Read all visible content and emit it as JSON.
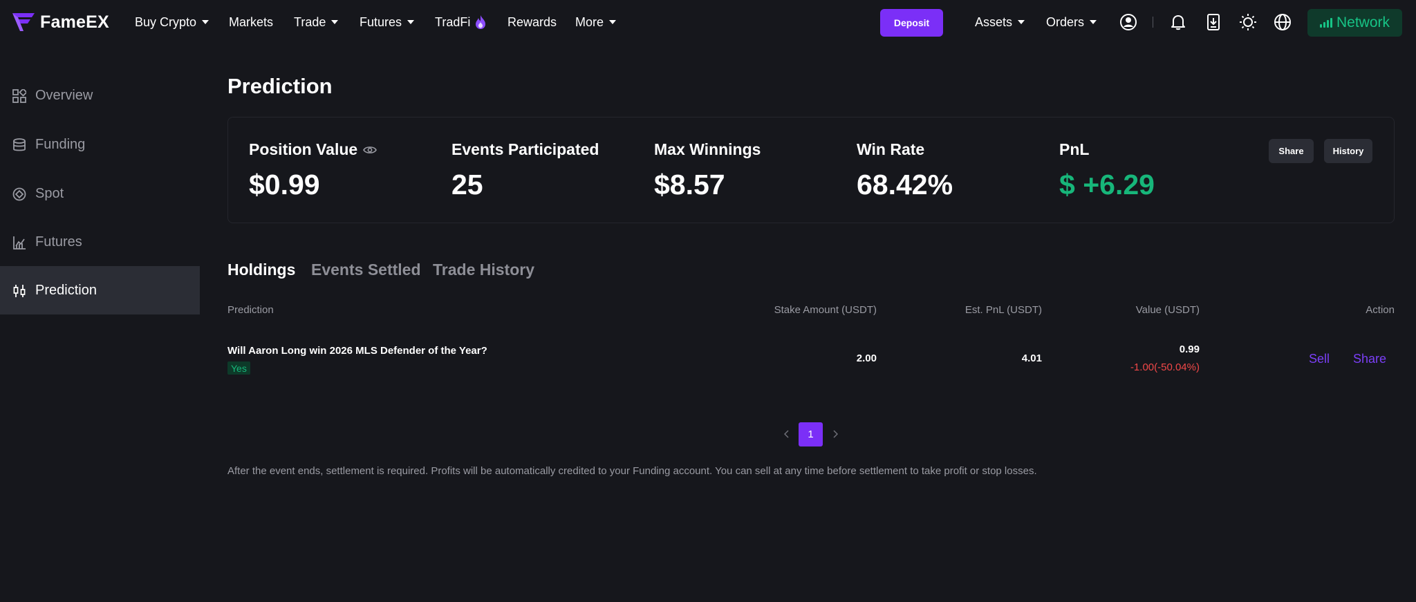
{
  "brand": {
    "name": "FameEX",
    "accent": "#7b2ff7",
    "positive": "#17b67a",
    "negative": "#f04848"
  },
  "nav": {
    "buy_crypto": "Buy Crypto",
    "markets": "Markets",
    "trade": "Trade",
    "futures": "Futures",
    "tradfi": "TradFi",
    "rewards": "Rewards",
    "more": "More",
    "deposit": "Deposit",
    "assets": "Assets",
    "orders": "Orders",
    "network": "Network",
    "icons": [
      "user-icon",
      "bell-icon",
      "download-app-icon",
      "sun-icon",
      "globe-icon"
    ]
  },
  "sidebar": {
    "items": [
      {
        "label": "Overview",
        "icon": "grid-icon",
        "active": false
      },
      {
        "label": "Funding",
        "icon": "database-icon",
        "active": false
      },
      {
        "label": "Spot",
        "icon": "target-icon",
        "active": false
      },
      {
        "label": "Futures",
        "icon": "chart-icon",
        "active": false
      },
      {
        "label": "Prediction",
        "icon": "candlestick-icon",
        "active": true
      }
    ]
  },
  "page": {
    "title": "Prediction"
  },
  "stats": {
    "position_value": {
      "label": "Position Value",
      "value": "$0.99"
    },
    "events_participated": {
      "label": "Events Participated",
      "value": "25"
    },
    "max_winnings": {
      "label": "Max Winnings",
      "value": "$8.57"
    },
    "win_rate": {
      "label": "Win Rate",
      "value": "68.42%"
    },
    "pnl": {
      "label": "PnL",
      "value": "$ +6.29"
    },
    "share_label": "Share",
    "history_label": "History"
  },
  "tabs": [
    {
      "label": "Holdings",
      "active": true
    },
    {
      "label": "Events Settled",
      "active": false
    },
    {
      "label": "Trade History",
      "active": false
    }
  ],
  "table": {
    "headers": {
      "prediction": "Prediction",
      "stake": "Stake Amount (USDT)",
      "est_pnl": "Est. PnL (USDT)",
      "value": "Value (USDT)",
      "action": "Action"
    },
    "rows": [
      {
        "question": "Will Aaron Long win 2026 MLS Defender of the Year?",
        "outcome": "Yes",
        "stake": "2.00",
        "est_pnl": "4.01",
        "value": "0.99",
        "value_change": "-1.00(-50.04%)",
        "sell": "Sell",
        "share": "Share"
      }
    ]
  },
  "pagination": {
    "current": "1"
  },
  "footnote": "After the event ends, settlement is required. Profits will be automatically credited to your Funding account. You can sell at any time before settlement to take profit or stop losses."
}
